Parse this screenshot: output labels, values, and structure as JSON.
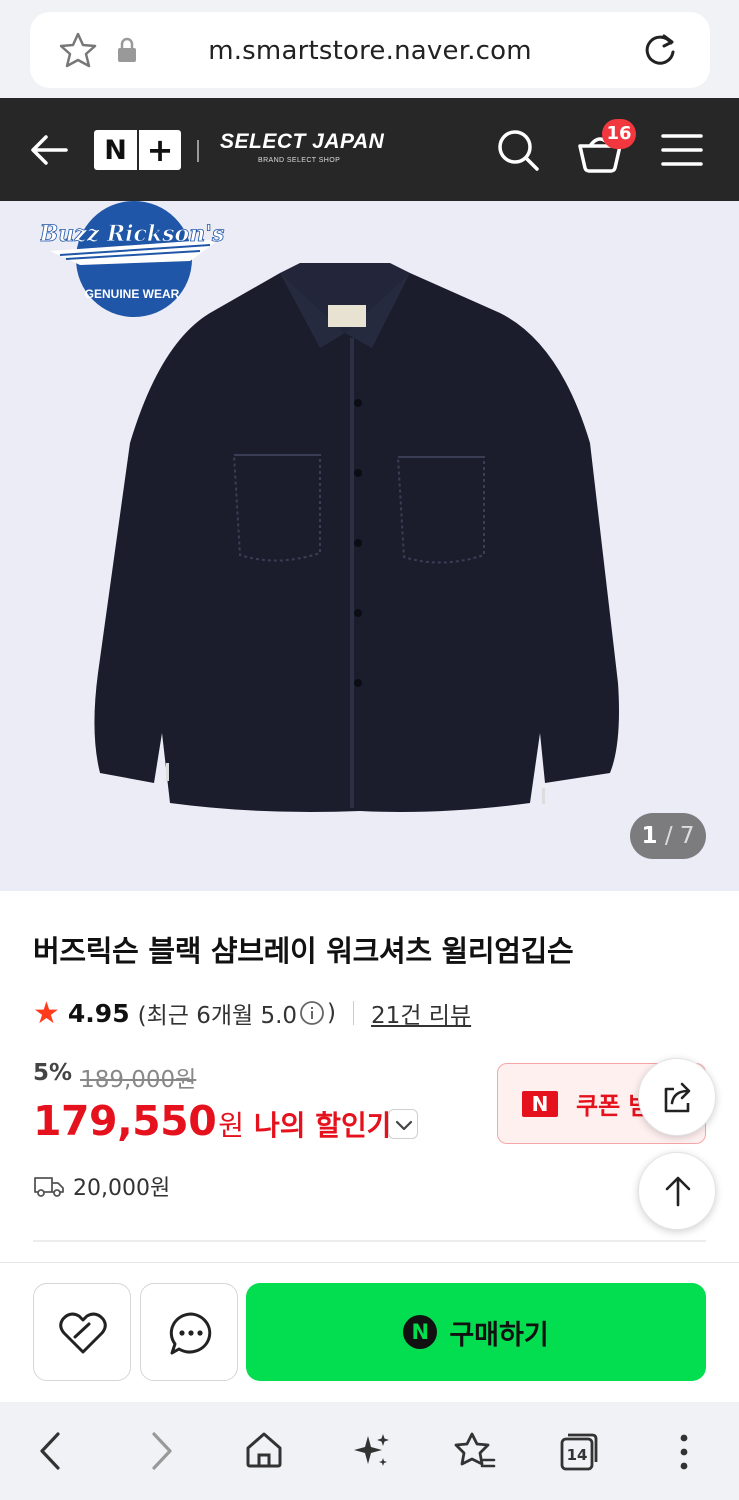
{
  "browser": {
    "url": "m.smartstore.naver.com",
    "tab_count": "14"
  },
  "header": {
    "logo_n": "N",
    "logo_plus": "+",
    "store_name": "SELECT JAPAN",
    "store_tagline": "BRAND SELECT SHOP",
    "cart_count": "16"
  },
  "hero": {
    "brand_logo_text": "Buzz Rickson's",
    "brand_logo_sub": "GENUINE WEAR",
    "image_index": "1",
    "image_sep": "/",
    "image_total": "7",
    "background": "#ececf7"
  },
  "product": {
    "title": "버즈릭슨 블랙 샴브레이 워크셔츠 윌리엄깁슨",
    "rating": "4.95",
    "rating_recent": "(최근 6개월 5.0",
    "rating_recent_close": ")",
    "review_link": "21건 리뷰",
    "discount_pct": "5%",
    "original_price": "189,000원",
    "sale_price": "179,550",
    "currency": "원",
    "my_discount_label": "나의 할인가",
    "shipping_fee": "20,000원",
    "coupon_badge": "N",
    "coupon_label": "쿠폰 받"
  },
  "actions": {
    "buy_badge": "N",
    "buy_label": "구매하기"
  },
  "colors": {
    "accent_red": "#e5111c",
    "naver_green": "#03de50",
    "header_bg": "#272727"
  }
}
